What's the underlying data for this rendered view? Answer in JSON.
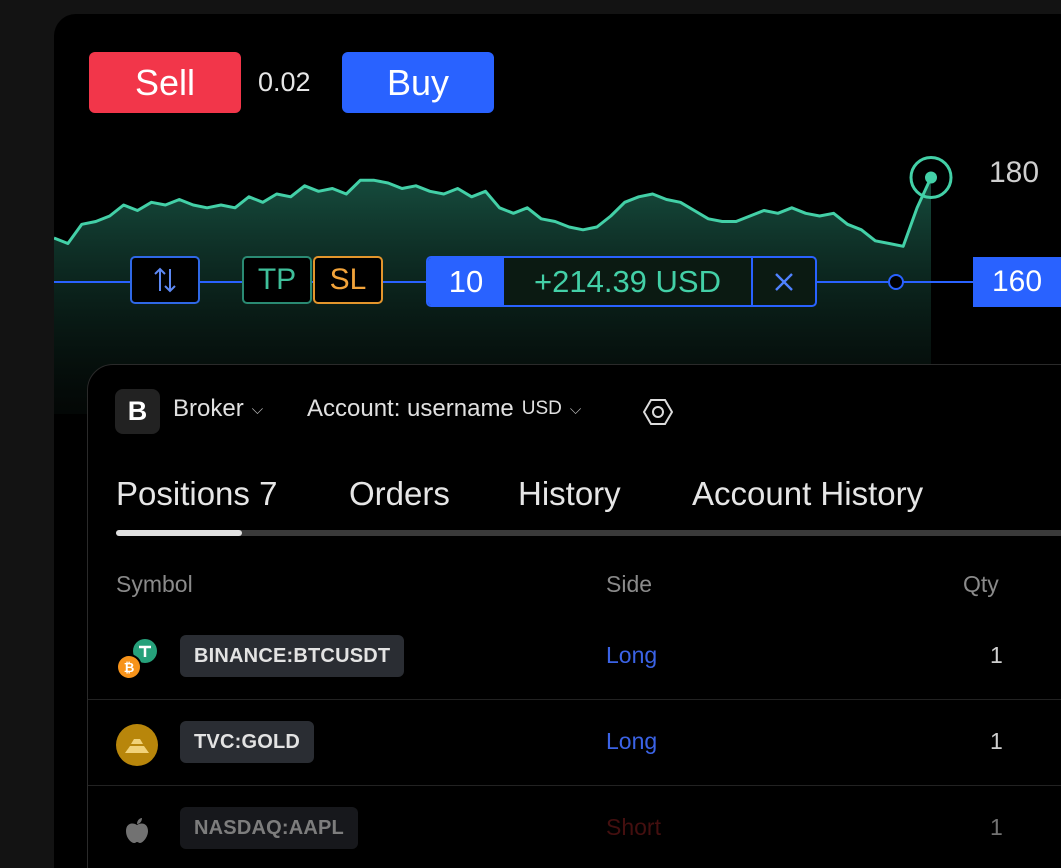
{
  "trade_bar": {
    "sell_label": "Sell",
    "quantity": "0.02",
    "buy_label": "Buy"
  },
  "price_axis": {
    "upper": "180",
    "current": "160"
  },
  "position_line": {
    "tp_label": "TP",
    "sl_label": "SL",
    "quantity": "10",
    "pnl": "+214.39 USD"
  },
  "chart_data": {
    "type": "area",
    "price_labels": [
      "180",
      "160"
    ],
    "y_values": [
      168,
      167,
      170.5,
      171,
      172,
      174,
      173,
      174.5,
      174,
      175,
      174,
      173.5,
      174,
      173.5,
      175.5,
      174.5,
      176,
      175.5,
      177.5,
      176.5,
      177,
      176,
      178.5,
      178.5,
      178,
      177,
      177.5,
      176.5,
      176,
      177,
      175.5,
      176.5,
      173.5,
      172.5,
      173.5,
      171.5,
      171,
      170,
      169.5,
      170,
      172,
      174.5,
      175.5,
      176,
      175,
      174.5,
      173,
      171.5,
      171,
      171,
      172,
      173,
      172.5,
      173.5,
      172.5,
      172,
      172.5,
      170.5,
      169.5,
      167.5,
      167,
      166.5,
      173.5,
      179
    ],
    "current_price": 160
  },
  "panel": {
    "broker": {
      "logo_letter": "B",
      "label": "Broker"
    },
    "account": {
      "label": "Account: username",
      "currency": "USD"
    },
    "tabs": [
      {
        "label": "Positions 7",
        "active": true
      },
      {
        "label": "Orders"
      },
      {
        "label": "History"
      },
      {
        "label": "Account History"
      }
    ],
    "columns": {
      "symbol": "Symbol",
      "side": "Side",
      "qty": "Qty"
    },
    "rows": [
      {
        "symbol": "BINANCE:BTCUSDT",
        "side": "Long",
        "qty": "1",
        "icon": "bitcoin-tether-icon"
      },
      {
        "symbol": "TVC:GOLD",
        "side": "Long",
        "qty": "1",
        "icon": "gold-icon"
      },
      {
        "symbol": "NASDAQ:AAPL",
        "side": "Short",
        "qty": "1",
        "icon": "apple-icon"
      }
    ]
  },
  "colors": {
    "sell": "#f2364a",
    "buy": "#2962ff",
    "line": "#43d0a7",
    "tp": "#3fbf9a",
    "sl": "#f2a33a"
  }
}
